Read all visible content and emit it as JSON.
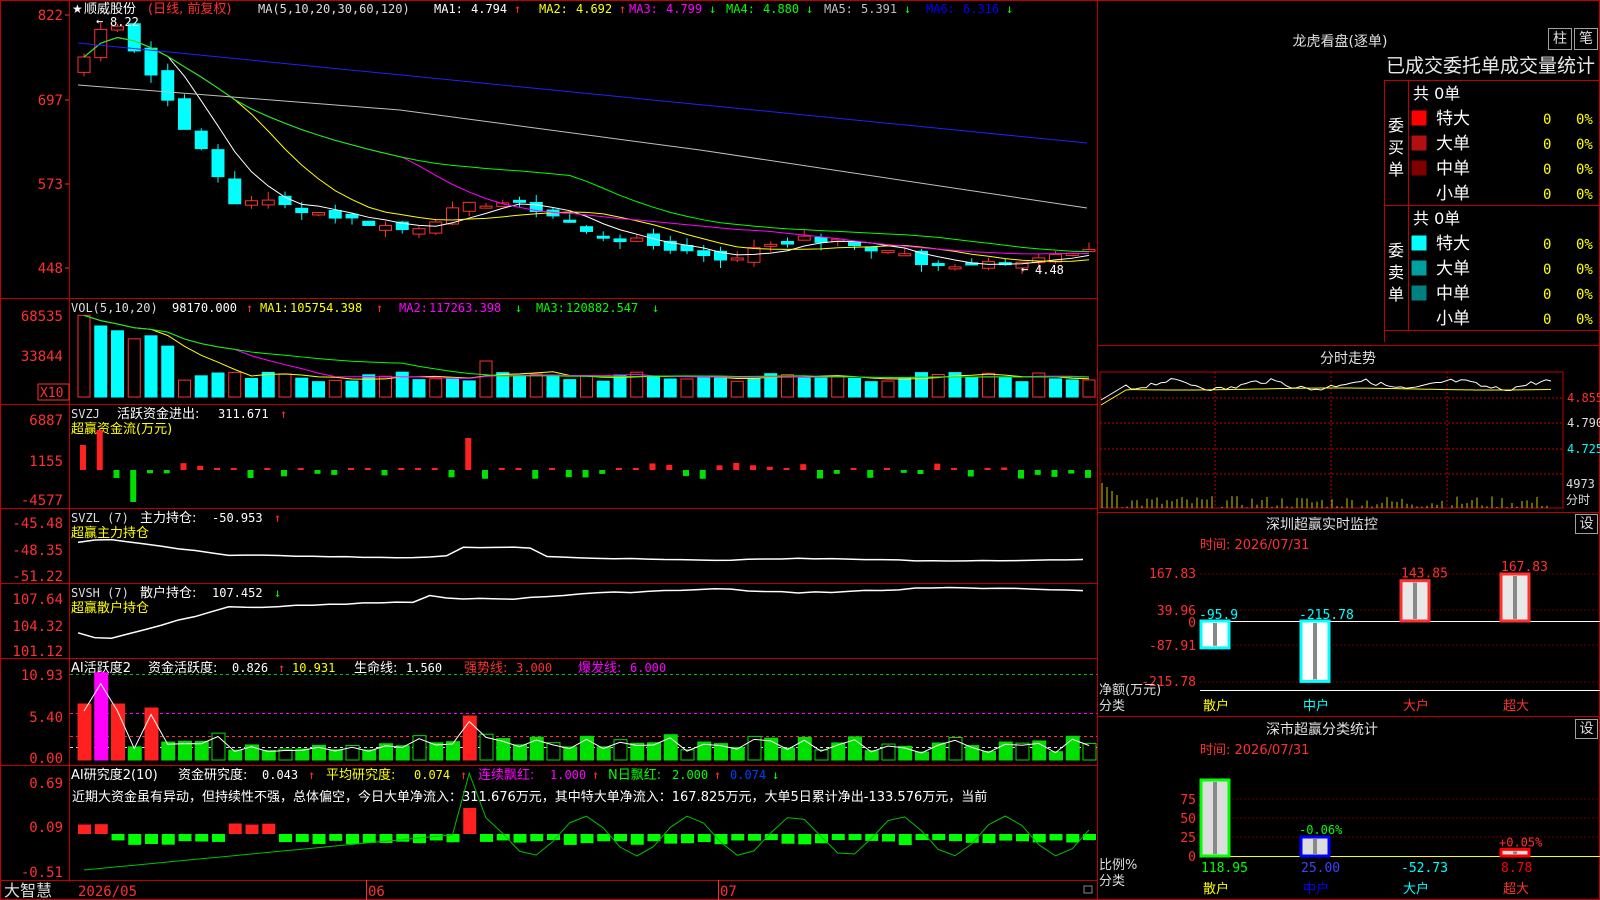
{
  "app": {
    "brand": "大智慧"
  },
  "stock": {
    "name": "顺威股份",
    "star": "★",
    "period": "(日线, 前复权)",
    "ma_label": "MA(5,10,20,30,60,120)",
    "ma": [
      {
        "label": "MA1:",
        "value": "4.794",
        "arrow": "↑",
        "color": "#ffffff"
      },
      {
        "label": "MA2:",
        "value": "4.692",
        "arrow": "↑",
        "color": "#ffff00"
      },
      {
        "label": "MA3:",
        "value": "4.799",
        "arrow": "↓",
        "color": "#ff00ff"
      },
      {
        "label": "MA4:",
        "value": "4.880",
        "arrow": "↓",
        "color": "#00ff00"
      },
      {
        "label": "MA5:",
        "value": "5.391",
        "arrow": "↓",
        "color": "#c0c0c0"
      },
      {
        "label": "MA6:",
        "value": "6.316",
        "arrow": "↓",
        "color": "#0000ff"
      }
    ],
    "high_mark": "8.22",
    "low_mark": "4.48",
    "price_axis": [
      "822",
      "697",
      "573",
      "448"
    ]
  },
  "vol": {
    "label": "VOL(5,10,20)",
    "value": "98170.000",
    "arrow": "↑",
    "ma": [
      {
        "label": "MA1:",
        "value": "105754.398",
        "arrow": "↑",
        "color": "#ffff00"
      },
      {
        "label": "MA2:",
        "value": "117263.398",
        "arrow": "↓",
        "color": "#ff00ff"
      },
      {
        "label": "MA3:",
        "value": "120882.547",
        "arrow": "↓",
        "color": "#00ff00"
      }
    ],
    "axis": [
      "68535",
      "33844"
    ],
    "unit": "X10"
  },
  "svzj": {
    "label": "SVZJ",
    "line_label": "活跃资金进出:",
    "value": "311.671",
    "arrow": "↑",
    "sub": "超赢资金流(万元)",
    "axis": [
      "6887",
      "1155",
      "-4577"
    ]
  },
  "svzl": {
    "label": "SVZL (7)",
    "line_label": "主力持仓:",
    "value": "-50.953",
    "arrow": "↑",
    "sub": "超赢主力持仓",
    "axis": [
      "-45.48",
      "-48.35",
      "-51.22"
    ]
  },
  "svsh": {
    "label": "SVSH (7)",
    "line_label": "散户持仓:",
    "value": "107.452",
    "arrow": "↓",
    "sub": "超赢散户持仓",
    "axis": [
      "107.64",
      "104.32",
      "101.12"
    ]
  },
  "ai_act": {
    "label": "AI活跃度2",
    "line_label": "资金活跃度:",
    "value": "0.826",
    "arrow": "↑",
    "v2": "10.931",
    "life_label": "生命线:",
    "life": "1.560",
    "strong_label": "强势线:",
    "strong": "3.000",
    "burst_label": "爆发线:",
    "burst": "6.000",
    "axis": [
      "10.93",
      "5.40",
      "0.00"
    ]
  },
  "ai_res": {
    "label": "AI研究度2(10)",
    "line_label": "资金研究度:",
    "value": "0.043",
    "arrow": "↑",
    "avg_label": "平均研究度:",
    "avg": "0.074",
    "arrow2": "↑",
    "red_label": "连续飘红:",
    "red": "1.000",
    "arrow3": "↑",
    "nred_label": "N日飘红:",
    "nred": "2.000",
    "arrow4": "↑",
    "last": "0.074",
    "arrow5": "↓",
    "desc": "近期大资金虽有异动，但持续性不强，总体偏空，今日大单净流入：311.676万元，其中特大单净流入：167.825万元，大单5日累计净出-133.576万元，当前",
    "axis": [
      "0.69",
      "0.09",
      "-0.51"
    ]
  },
  "date_axis": [
    "2026/05",
    "06",
    "07"
  ],
  "right": {
    "longhu_title": "龙虎看盘(逐单)",
    "btn_zhu": "柱",
    "btn_bi": "笔",
    "stats_title": "已成交委托单成交量统计",
    "buy": {
      "label": "委买单",
      "total": "共 0单",
      "rows": [
        {
          "name": "特大",
          "color": "#ff0000",
          "count": "0",
          "pct": "0%"
        },
        {
          "name": "大单",
          "color": "#b01010",
          "count": "0",
          "pct": "0%"
        },
        {
          "name": "中单",
          "color": "#800000",
          "count": "0",
          "pct": "0%"
        },
        {
          "name": "小单",
          "color": "#000000",
          "count": "0",
          "pct": "0%"
        }
      ]
    },
    "sell": {
      "label": "委卖单",
      "total": "共 0单",
      "rows": [
        {
          "name": "特大",
          "color": "#00ffff",
          "count": "0",
          "pct": "0%"
        },
        {
          "name": "大单",
          "color": "#00a0a0",
          "count": "0",
          "pct": "0%"
        },
        {
          "name": "中单",
          "color": "#008080",
          "count": "0",
          "pct": "0%"
        },
        {
          "name": "小单",
          "color": "#000000",
          "count": "0",
          "pct": "0%"
        }
      ]
    },
    "intraday_title": "分时走势",
    "intraday_axis": [
      "4.855",
      "4.790",
      "4.725"
    ],
    "intraday_vol": "4973",
    "intraday_vol_label": "分时",
    "sz_title": "深圳超赢实时监控",
    "time_label": "时间: 2026/07/31",
    "set_btn": "设",
    "sz_axis": [
      "167.83",
      "39.96",
      "0",
      "-87.91",
      "-215.78"
    ],
    "sz_ylabel": "净额(万元)",
    "cat_label": "分类",
    "sz_bars": [
      {
        "cat": "散户",
        "value": -95.9,
        "label": "-95.9"
      },
      {
        "cat": "中户",
        "value": -215.78,
        "label": "-215.78"
      },
      {
        "cat": "大户",
        "value": 143.85,
        "label": "143.85"
      },
      {
        "cat": "超大",
        "value": 167.83,
        "label": "167.83"
      }
    ],
    "sh_title": "深市超赢分类统计",
    "sh_time_label": "时间: 2026/07/31",
    "sh_axis": [
      "75",
      "50",
      "25",
      "0"
    ],
    "sh_ylabel": "比例%",
    "sh_bars": [
      {
        "cat": "散户",
        "value": 118.95,
        "label": "118.95",
        "color": "#00ff00",
        "top": ""
      },
      {
        "cat": "中户",
        "value": 25.0,
        "label": "25.00",
        "color": "#0000ff",
        "top": "-0.06%"
      },
      {
        "cat": "大户",
        "value": -52.73,
        "label": "-52.73",
        "color": "#00ffff",
        "top": ""
      },
      {
        "cat": "超大",
        "value": 8.78,
        "label": "8.78",
        "color": "#ff0000",
        "top": "+0.05%"
      }
    ]
  }
}
